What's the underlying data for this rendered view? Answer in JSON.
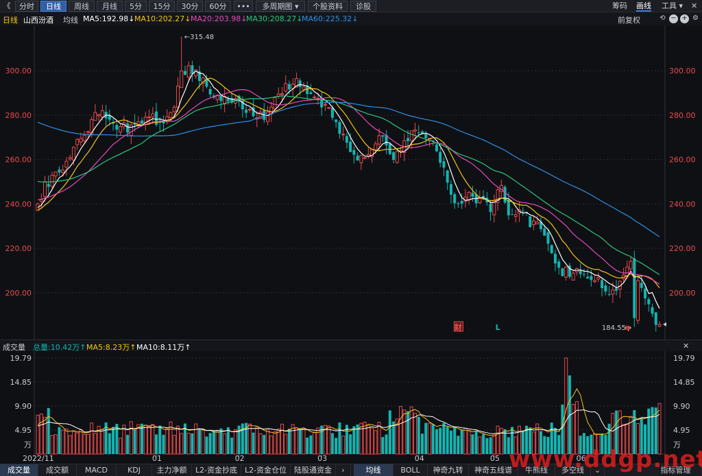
{
  "colors": {
    "up": "#e74c4c",
    "down": "#13b5b1",
    "ma5": "#ffffff",
    "ma10": "#f5c518",
    "ma20": "#e84bbd",
    "ma30": "#2ec77a",
    "ma60": "#2e8fe6",
    "axis_label": "#e74c4c",
    "grid": "#2a2c33"
  },
  "toolbar": {
    "back_icon": "《",
    "periods": [
      "分时",
      "日线",
      "周线",
      "月线",
      "5分",
      "15分",
      "30分",
      "60分",
      "•••",
      "多周期图 ▾",
      "个股资料",
      "诊股"
    ],
    "active_period": "日线",
    "right": [
      "筹码",
      "画线",
      "工具 ▾"
    ],
    "close_icon": "✕"
  },
  "info": {
    "period": "日线",
    "stock_name": "山西汾酒",
    "avg_label": "均线",
    "ma5": "MA5:192.98↓",
    "ma10": "MA10:202.27↓",
    "ma20": "MA20:203.98↓",
    "ma30": "MA30:208.27↓",
    "ma60": "MA60:225.32↓",
    "adjust": "前复权",
    "icons": [
      "undo-icon",
      "minus-icon",
      "plus-icon",
      "settings-icon"
    ]
  },
  "chart_data": {
    "type": "candlestick",
    "ylim": [
      182,
      318
    ],
    "y_ticks": [
      200,
      220,
      240,
      260,
      280,
      300
    ],
    "y_tick_labels": [
      "200.00",
      "220.00",
      "240.00",
      "260.00",
      "280.00",
      "300.00"
    ],
    "x_labels": [
      {
        "label": "2022/11",
        "index": 0
      },
      {
        "label": "01",
        "index": 33
      },
      {
        "label": "02",
        "index": 56
      },
      {
        "label": "03",
        "index": 79
      },
      {
        "label": "04",
        "index": 106
      },
      {
        "label": "05",
        "index": 127
      },
      {
        "label": "06",
        "index": 151
      }
    ],
    "high_label": "315.48",
    "high_index": 40,
    "high_value": 315.48,
    "low_label": "184.55",
    "low_index": 166,
    "low_value": 184.55,
    "markers": [
      {
        "label": "财",
        "index": 117,
        "color": "#e74c4c",
        "boxed": true
      },
      {
        "label": "L",
        "index": 128,
        "color": "#13b5b1",
        "boxed": false
      },
      {
        "label": "q",
        "index": 164,
        "color": "#e74c4c",
        "boxed": false
      }
    ],
    "close_anchors": [
      [
        0,
        240
      ],
      [
        2,
        248
      ],
      [
        5,
        252
      ],
      [
        8,
        260
      ],
      [
        11,
        270
      ],
      [
        14,
        275
      ],
      [
        17,
        282
      ],
      [
        20,
        276
      ],
      [
        23,
        274
      ],
      [
        26,
        275
      ],
      [
        29,
        278
      ],
      [
        32,
        279
      ],
      [
        35,
        276
      ],
      [
        38,
        285
      ],
      [
        40,
        300
      ],
      [
        42,
        301
      ],
      [
        45,
        297
      ],
      [
        48,
        289
      ],
      [
        51,
        286
      ],
      [
        54,
        286
      ],
      [
        57,
        284
      ],
      [
        60,
        281
      ],
      [
        63,
        278
      ],
      [
        66,
        287
      ],
      [
        69,
        293
      ],
      [
        72,
        294
      ],
      [
        75,
        290
      ],
      [
        78,
        286
      ],
      [
        81,
        282
      ],
      [
        84,
        274
      ],
      [
        87,
        265
      ],
      [
        90,
        260
      ],
      [
        93,
        267
      ],
      [
        96,
        270
      ],
      [
        99,
        262
      ],
      [
        102,
        268
      ],
      [
        105,
        272
      ],
      [
        108,
        270
      ],
      [
        111,
        266
      ],
      [
        113,
        256
      ],
      [
        115,
        245
      ],
      [
        118,
        238
      ],
      [
        120,
        244
      ],
      [
        123,
        242
      ],
      [
        126,
        238
      ],
      [
        129,
        247
      ],
      [
        131,
        237
      ],
      [
        134,
        237
      ],
      [
        137,
        232
      ],
      [
        140,
        230
      ],
      [
        143,
        218
      ],
      [
        146,
        209
      ],
      [
        149,
        210
      ],
      [
        152,
        206
      ],
      [
        155,
        206
      ],
      [
        158,
        203
      ],
      [
        160,
        199
      ],
      [
        163,
        209
      ],
      [
        165,
        214
      ],
      [
        167,
        205
      ],
      [
        169,
        196
      ],
      [
        171,
        190
      ],
      [
        173,
        186
      ]
    ],
    "ma_final": {
      "ma5": 192.98,
      "ma10": 202.27,
      "ma20": 203.98,
      "ma30": 208.27,
      "ma60": 225.32
    }
  },
  "volume": {
    "title": "成交量",
    "total": "总量:10.42万↑",
    "ma5": "MA5:8.23万↑",
    "ma10": "MA10:8.11万↑",
    "ylim": [
      0,
      19.79
    ],
    "y_ticks": [
      4.95,
      9.9,
      14.85,
      19.79
    ],
    "y_tick_labels": [
      "4.95",
      "9.90",
      "14.85",
      "19.79"
    ],
    "unit": "万",
    "close_icon": "✕"
  },
  "bottom_tabs": {
    "items": [
      "成交量",
      "成交额",
      "MACD",
      "KDJ",
      "主力净额",
      "L2-资金抄底",
      "L2-资金仓位",
      "陆股通资金",
      "›",
      "均线",
      "BOLL",
      "神奇九转",
      "神奇五线谱",
      "牛熊线",
      "多空线",
      "⌄",
      "指标管理"
    ],
    "active": [
      "成交量",
      "均线"
    ]
  },
  "watermark": "www.ddgp.net"
}
